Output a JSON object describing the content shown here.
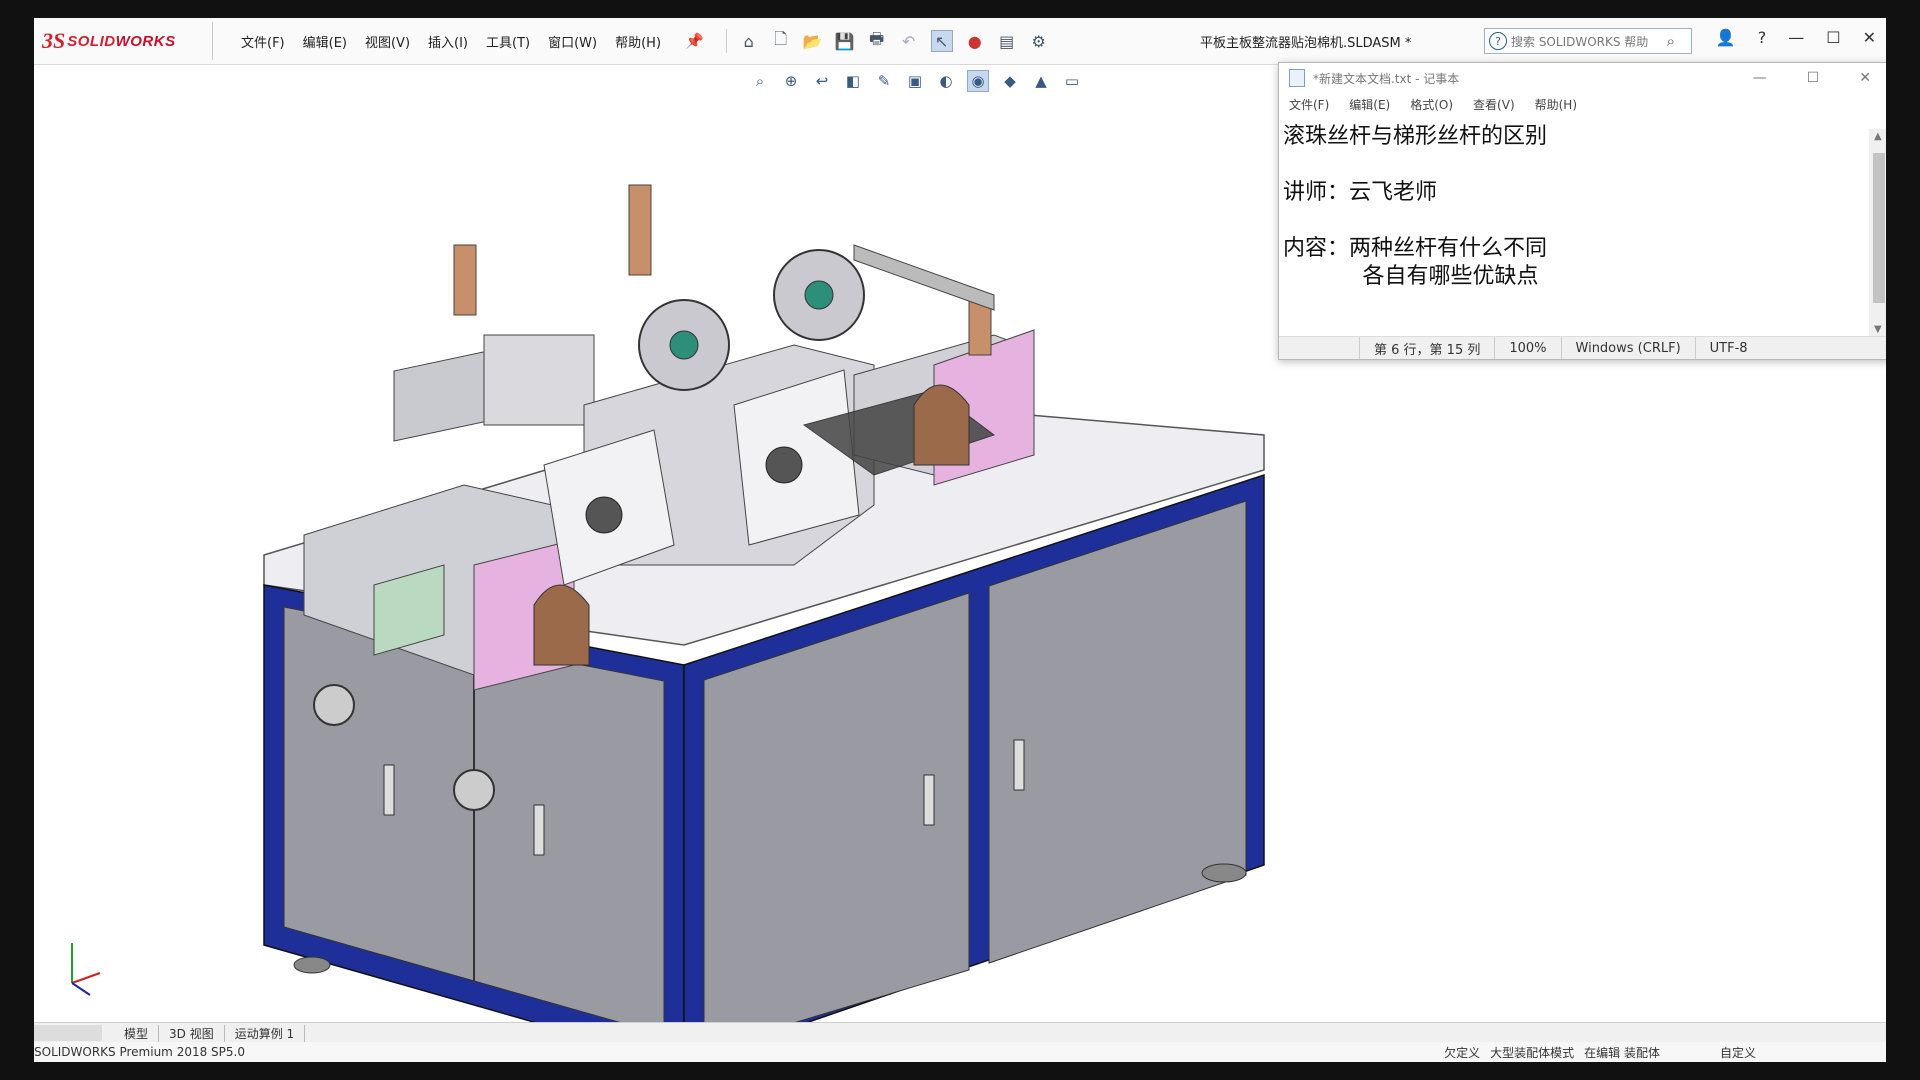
{
  "app": {
    "brand_ds": "3S",
    "brand_name_a": "SOLID",
    "brand_name_b": "WORKS",
    "document_title": "平板主板整流器贴泡棉机.SLDASM *",
    "search_placeholder": "搜索 SOLIDWORKS 帮助",
    "menus": [
      "文件(F)",
      "编辑(E)",
      "视图(V)",
      "插入(I)",
      "工具(T)",
      "窗口(W)",
      "帮助(H)"
    ]
  },
  "notepad": {
    "title": "*新建文本文档.txt - 记事本",
    "menus": [
      "文件(F)",
      "编辑(E)",
      "格式(O)",
      "查看(V)",
      "帮助(H)"
    ],
    "lines": [
      "滚珠丝杆与梯形丝杆的区别",
      "",
      "讲师：云飞老师",
      "",
      "内容：两种丝杆有什么不同",
      "      各自有哪些优缺点"
    ],
    "status": {
      "position": "第 6 行，第 15 列",
      "zoom": "100%",
      "line_ending": "Windows (CRLF)",
      "encoding": "UTF-8"
    }
  },
  "bottom_tabs": [
    "模型",
    "3D 视图",
    "运动算例 1"
  ],
  "status_bar": {
    "left": "SOLIDWORKS Premium 2018 SP5.0",
    "state": "欠定义",
    "mode": "大型装配体模式",
    "editing": "在编辑 装配体",
    "custom": "自定义"
  },
  "colors": {
    "frame_blue": "#1f2f9a",
    "cabinet_gray": "#9a9aa2",
    "pink_panel": "#e6b3e0",
    "brand_red": "#d3202f"
  }
}
